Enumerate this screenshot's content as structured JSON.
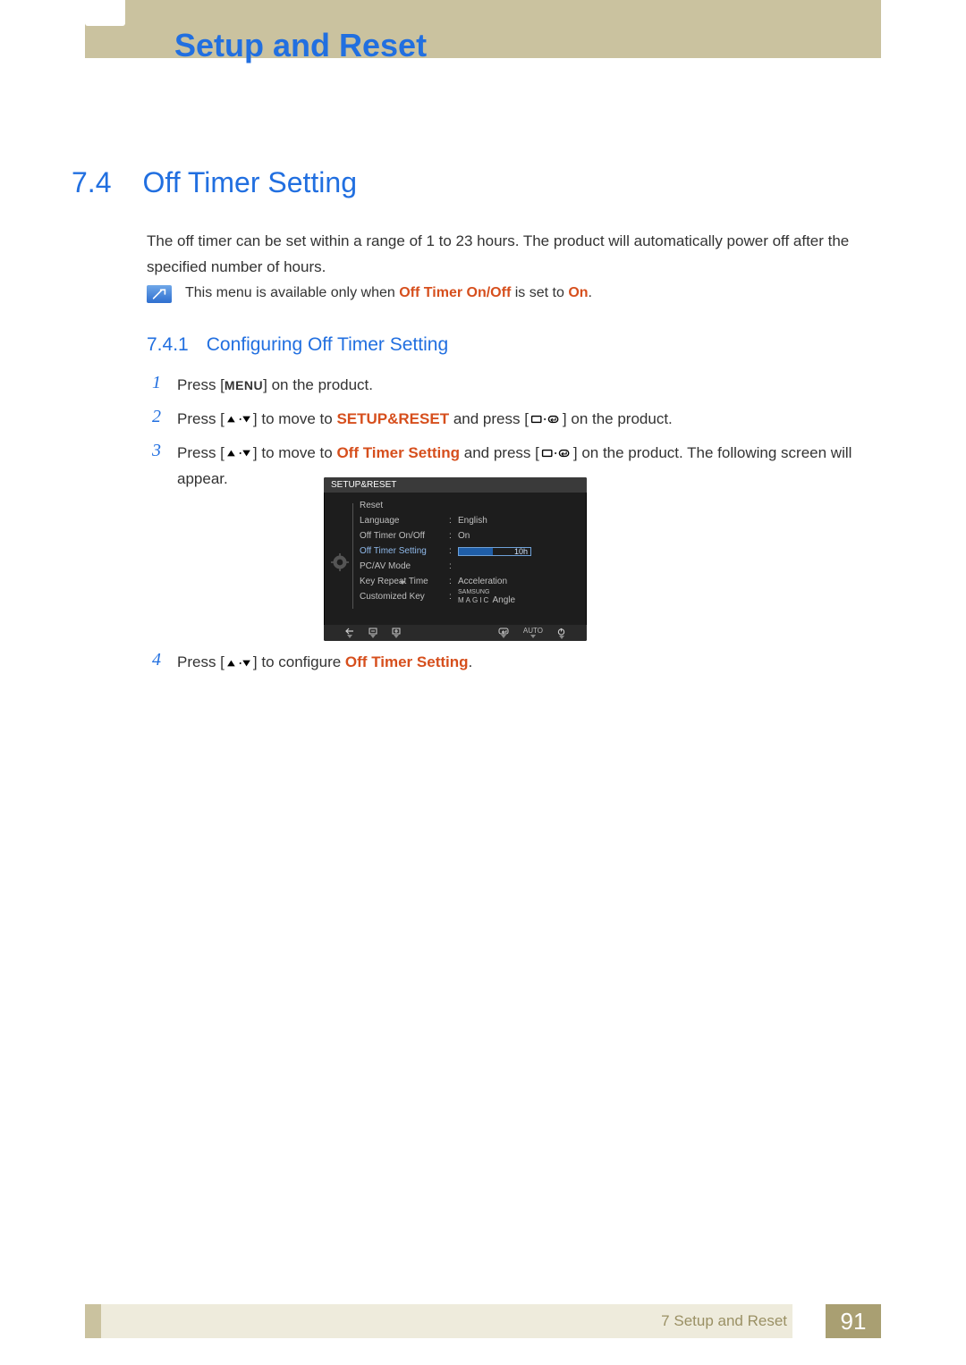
{
  "header": {
    "chapter_title": "Setup and Reset"
  },
  "section": {
    "number": "7.4",
    "title": "Off Timer Setting"
  },
  "intro_paragraph": "The off timer can be set within a range of 1 to 23 hours. The product will automatically power off after the specified number of hours.",
  "note": {
    "prefix": "This menu is available only when ",
    "bold1": "Off Timer On/Off",
    "mid": " is set to ",
    "bold2": "On",
    "suffix": "."
  },
  "subsection": {
    "number": "7.4.1",
    "title": "Configuring Off Timer Setting"
  },
  "steps": {
    "s1": {
      "num": "1",
      "a": "Press [",
      "menu": "MENU",
      "b": "] on the product."
    },
    "s2": {
      "num": "2",
      "a": "Press [",
      "b": "] to move to ",
      "target": "SETUP&RESET",
      "c": " and press [",
      "d": "] on the product."
    },
    "s3": {
      "num": "3",
      "a": "Press [",
      "b": "] to move to ",
      "target": "Off Timer Setting",
      "c": " and press [",
      "d": "] on the product. The following screen will appear."
    },
    "s4": {
      "num": "4",
      "a": "Press [",
      "b": "] to configure ",
      "target": "Off Timer Setting",
      "c": "."
    }
  },
  "osd": {
    "title": "SETUP&RESET",
    "rows": {
      "reset": "Reset",
      "language": "Language",
      "language_val": "English",
      "off_onoff": "Off Timer On/Off",
      "off_onoff_val": "On",
      "off_setting": "Off Timer Setting",
      "off_setting_val": "10h",
      "pcav": "PC/AV Mode",
      "keyrepeat": "Key Repeat Time",
      "keyrepeat_val": "Acceleration",
      "custkey": "Customized Key",
      "custkey_brand": "SAMSUNG",
      "custkey_magic": "MAGIC",
      "custkey_val": "Angle"
    },
    "nav": {
      "auto": "AUTO"
    }
  },
  "footer": {
    "chapter_ref": "7 Setup and Reset",
    "page": "91"
  }
}
